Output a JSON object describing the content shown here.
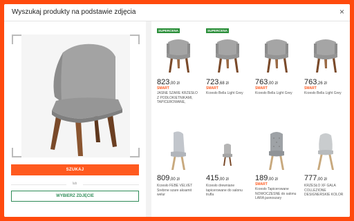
{
  "header": {
    "title": "Wyszukaj produkty na podstawie zdjęcia"
  },
  "left_panel": {
    "search_button": "SZUKAJ",
    "or_label": "lub",
    "choose_button": "WYBIERZ ZDJĘCIE"
  },
  "products": [
    {
      "badge": "SUPERCENA",
      "price_int": "823",
      "price_dec": ",00 zł",
      "smart": "SMART",
      "desc": "JASNE SZARE KRZESŁO Z PODŁOKIETNIKAMI, TAPICEROWANE,",
      "variant": "armchair"
    },
    {
      "badge": "SUPERCENA",
      "price_int": "723",
      "price_dec": ",68 zł",
      "smart": "SMART",
      "desc": "Krzesło Bella Light Grey",
      "variant": "armchair"
    },
    {
      "badge": "",
      "price_int": "763",
      "price_dec": ",00 zł",
      "smart": "SMART",
      "desc": "Krzesło Bella Light Grey",
      "variant": "armchair"
    },
    {
      "badge": "",
      "price_int": "763",
      "price_dec": ",26 zł",
      "smart": "SMART",
      "desc": "Krzesło Bella Light Grey",
      "variant": "armchair"
    },
    {
      "badge": "",
      "price_int": "809",
      "price_dec": ",00 zł",
      "smart": "",
      "desc": "Krzesło FEBE VELVET Srebrne szare aksamit welur",
      "variant": "tall"
    },
    {
      "badge": "",
      "price_int": "415",
      "price_dec": ",00 zł",
      "smart": "",
      "desc": "Krzesło drewniane tapicerowane do salonu trufla",
      "variant": "small"
    },
    {
      "badge": "",
      "price_int": "189",
      "price_dec": ",00 zł",
      "smart": "SMART",
      "desc": "Krzesło Tapicerowane NOWOCZESNE do salonu LARA jasnoszary",
      "variant": "tufted"
    },
    {
      "badge": "",
      "price_int": "777",
      "price_dec": ",00 zł",
      "smart": "",
      "desc": "KRZESŁO XF GALA COLLEZIONE DESIGNERSKIE KOLOR",
      "variant": "shell"
    }
  ],
  "colors": {
    "accent": "#ff5a1f",
    "green": "#2e8b57",
    "badge": "#2b8f3a",
    "fabric": "#9a9a9a",
    "wood": "#7a4a2a"
  }
}
